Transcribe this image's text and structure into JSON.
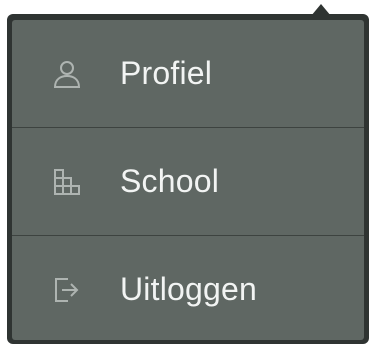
{
  "menu": {
    "items": [
      {
        "label": "Profiel",
        "icon": "person-icon"
      },
      {
        "label": "School",
        "icon": "building-icon"
      },
      {
        "label": "Uitloggen",
        "icon": "logout-icon"
      }
    ]
  },
  "colors": {
    "menu_bg": "#5f6763",
    "menu_border": "#2f3432",
    "text": "#f2f4f3",
    "icon": "#aeb4b1"
  }
}
